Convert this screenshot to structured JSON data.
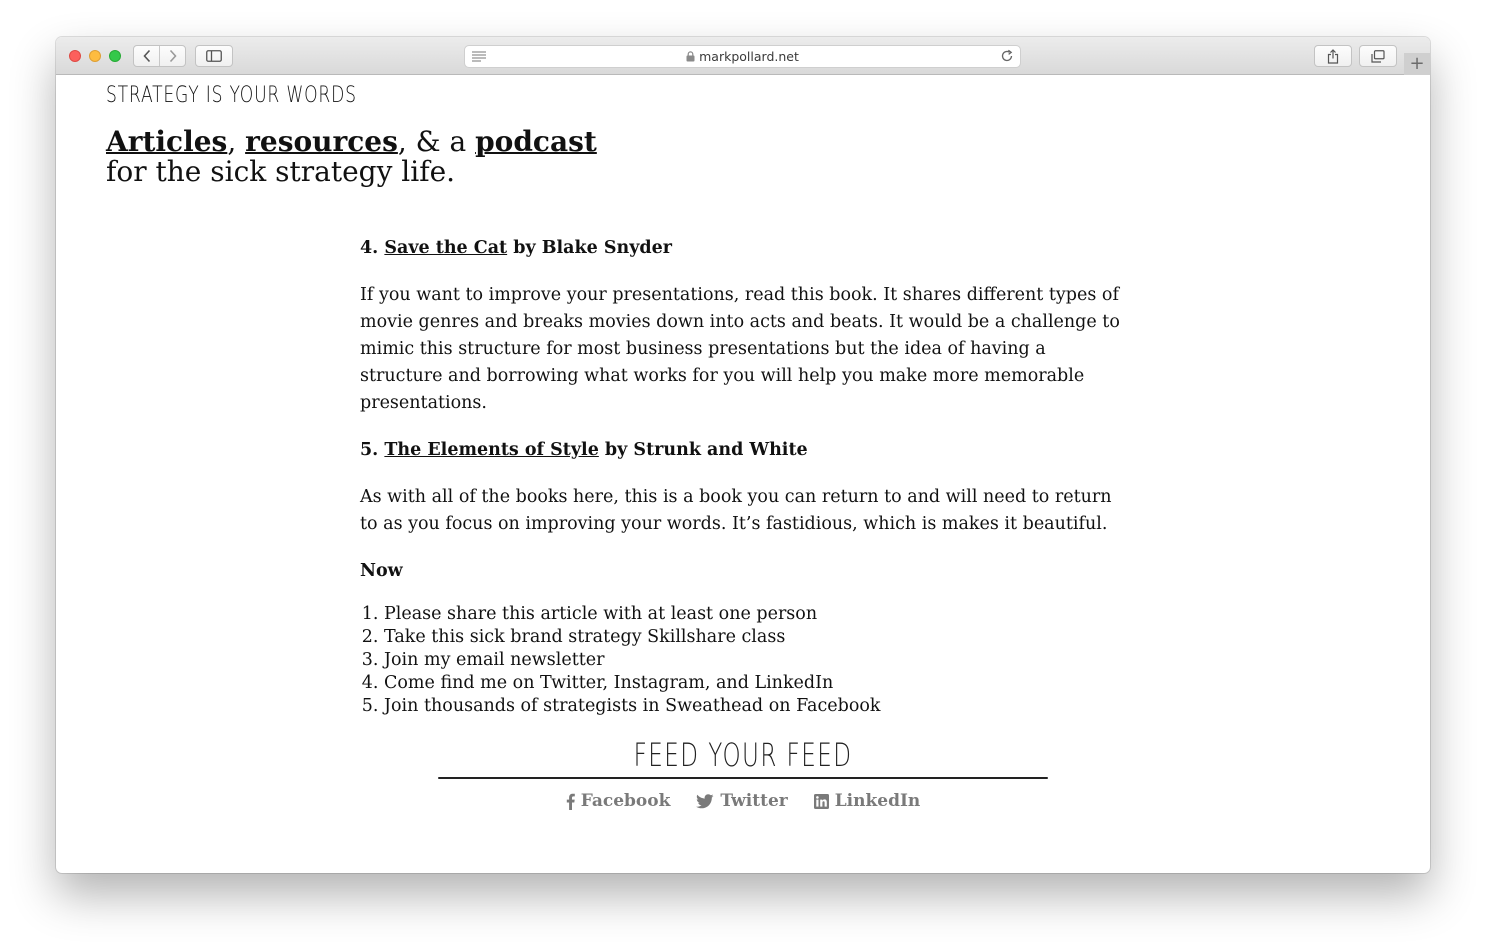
{
  "browser": {
    "url": "markpollard.net"
  },
  "site": {
    "tagline": "Strategy is your words",
    "hero": {
      "link_articles": "Articles",
      "sep1": ", ",
      "link_resources": "resources",
      "sep2": ", & a ",
      "link_podcast": "podcast",
      "line2": "for the sick strategy life."
    }
  },
  "article": {
    "book4": {
      "number": "4. ",
      "title": "Save the Cat",
      "author": " by Blake Snyder",
      "body": "If you want to improve your presentations, read this book. It shares different types of movie genres and breaks movies down into acts and beats. It would be a challenge to mimic this structure for most business presentations but the idea of having a structure and borrowing what works for you will help you make more memorable presentations."
    },
    "book5": {
      "number": "5. ",
      "title": "The Elements of Style",
      "author": " by Strunk and White",
      "body": "As with all of the books here, this is a book you can return to and will need to return to as you focus on improving your words. It’s fastidious, which is makes it beautiful."
    },
    "now_heading": "Now",
    "now_items": [
      "Please share this article with at least one person",
      "Take this sick brand strategy Skillshare class",
      "Join my email newsletter",
      "Come find me on Twitter, Instagram, and LinkedIn",
      "Join thousands of strategists in Sweathead on Facebook"
    ]
  },
  "footer": {
    "title": "Feed your feed",
    "social": [
      {
        "label": "Facebook",
        "icon": "facebook-icon"
      },
      {
        "label": "Twitter",
        "icon": "twitter-icon"
      },
      {
        "label": "LinkedIn",
        "icon": "linkedin-icon"
      }
    ]
  },
  "colors": {
    "text": "#111111",
    "social_gray": "#7a7a7a"
  }
}
